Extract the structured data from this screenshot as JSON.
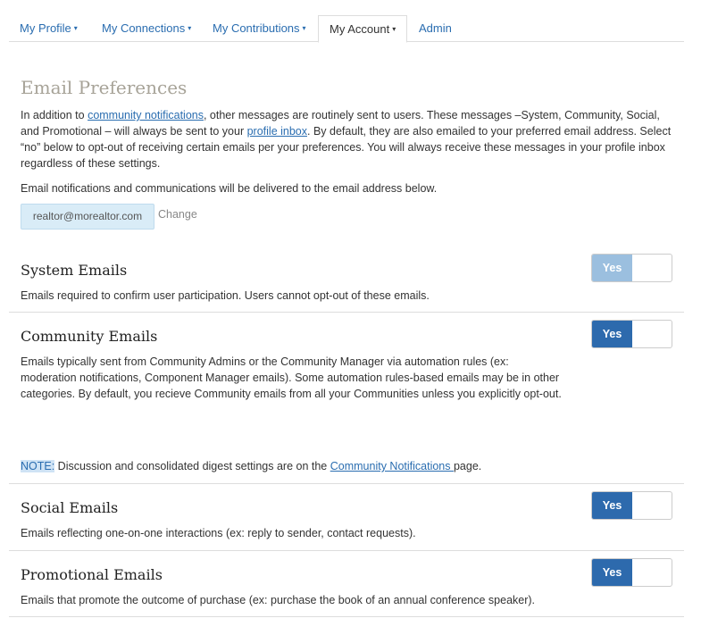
{
  "tabs": [
    {
      "label": "My Profile",
      "caret": "▾"
    },
    {
      "label": "My Connections",
      "caret": "▾"
    },
    {
      "label": "My Contributions",
      "caret": "▾"
    },
    {
      "label": "My Account",
      "caret": "▾"
    },
    {
      "label": "Admin",
      "caret": ""
    }
  ],
  "page": {
    "title": "Email Preferences",
    "intro": {
      "t1": "In addition to ",
      "link1": "community notifications",
      "t2": ", other messages are routinely sent to users. These messages –System, Community, Social, and Promotional – will always be sent to your ",
      "link2": "profile inbox",
      "t3": ". By default, they are also emailed to your preferred email address. Select “no” below to opt-out of receiving certain emails per your preferences. You will always receive these messages in your profile inbox regardless of these settings."
    },
    "deliver_text": "Email notifications and communications will be delivered to the email address below.",
    "email": "realtor@morealtor.com",
    "change_label": "Change"
  },
  "sections": {
    "system": {
      "title": "System Emails",
      "desc": "Emails required to confirm user participation. Users cannot opt-out of these emails.",
      "toggle": "Yes"
    },
    "community": {
      "title": "Community Emails",
      "desc": "Emails typically sent from Community Admins or the Community Manager via automation rules (ex: moderation notifications, Component Manager emails). Some automation rules-based emails may be in other categories. By default, you recieve Community emails from all your Communities unless you explicitly opt-out.",
      "toggle": "Yes"
    },
    "note": {
      "label": "NOTE:",
      "t1": " Discussion and consolidated digest settings are on the ",
      "link": "Community Notifications ",
      "t2": "page."
    },
    "social": {
      "title": "Social Emails",
      "desc": "Emails reflecting one-on-one interactions (ex: reply to sender, contact requests).",
      "toggle": "Yes"
    },
    "promotional": {
      "title": "Promotional Emails",
      "desc": "Emails that promote the outcome of purchase (ex: purchase the book of an annual conference speaker).",
      "toggle": "Yes"
    }
  },
  "colors": {
    "link": "#2a6db0",
    "toggle_on": "#2d6aad",
    "toggle_disabled": "#9bbfdf",
    "email_field_bg": "#d9ecf7",
    "title_gray": "#a7a398"
  }
}
